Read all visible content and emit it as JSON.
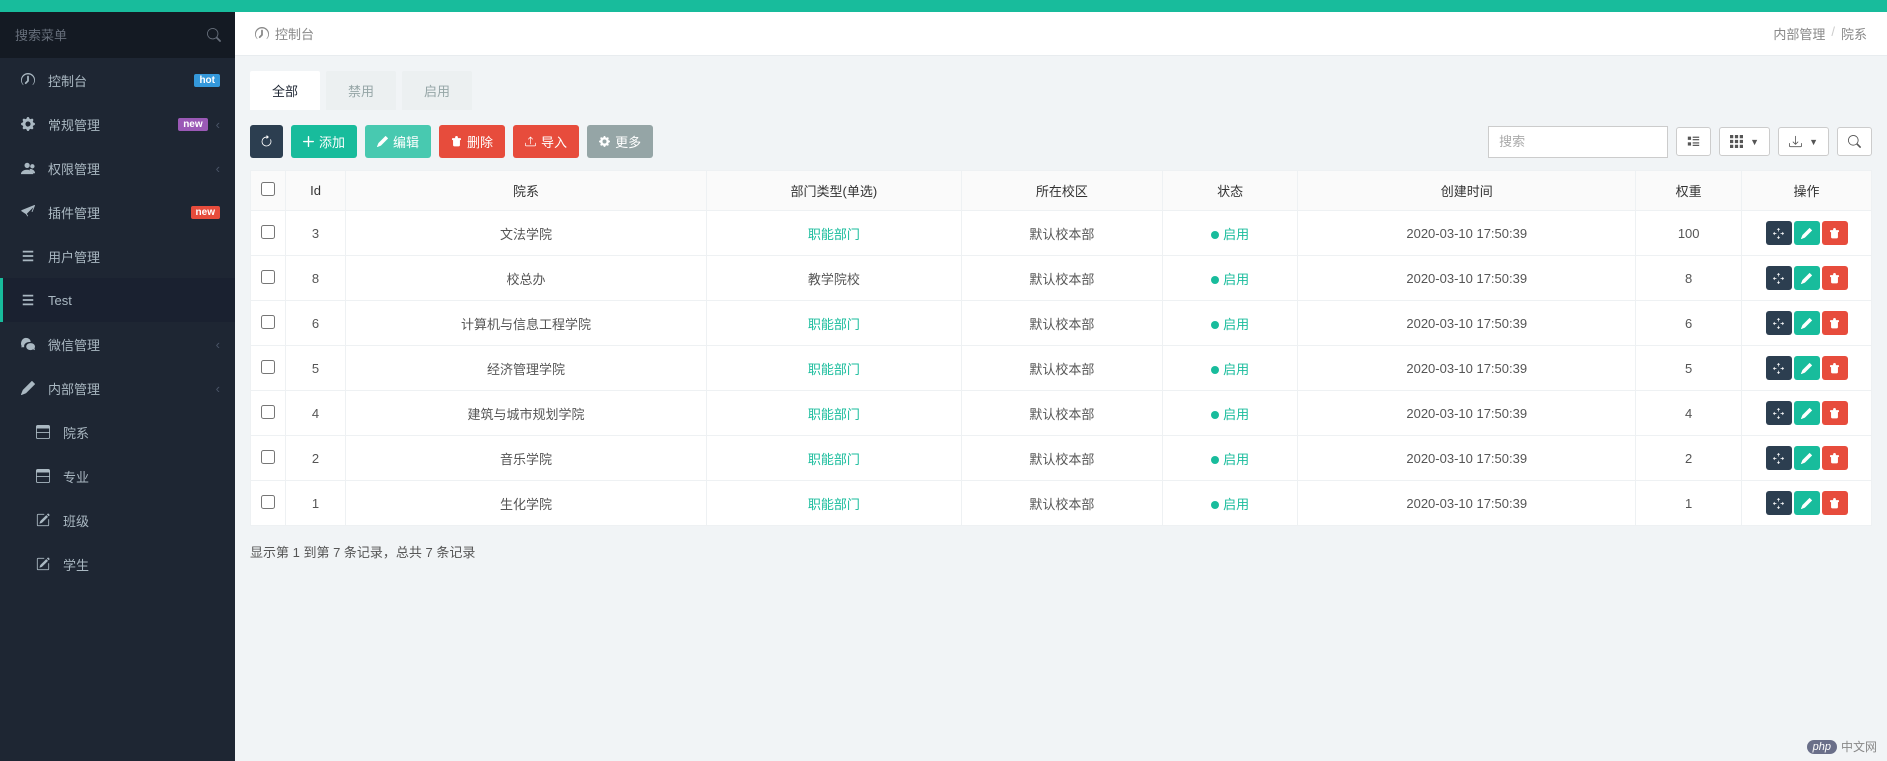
{
  "sidebar": {
    "search_placeholder": "搜索菜单",
    "items": [
      {
        "icon": "dashboard",
        "label": "控制台",
        "badge": "hot",
        "badge_class": "badge-hot"
      },
      {
        "icon": "gear",
        "label": "常规管理",
        "badge": "new",
        "badge_class": "badge-new",
        "caret": true
      },
      {
        "icon": "users",
        "label": "权限管理",
        "caret": true
      },
      {
        "icon": "plane",
        "label": "插件管理",
        "badge": "new",
        "badge_class": "badge-new-red"
      },
      {
        "icon": "list",
        "label": "用户管理"
      },
      {
        "icon": "list",
        "label": "Test",
        "active": true
      },
      {
        "icon": "wechat",
        "label": "微信管理",
        "caret": true
      },
      {
        "icon": "pencil",
        "label": "内部管理",
        "caret": true,
        "selected_box": true
      }
    ],
    "sub_items": [
      {
        "icon": "table",
        "label": "院系"
      },
      {
        "icon": "table",
        "label": "专业"
      },
      {
        "icon": "edit",
        "label": "班级"
      },
      {
        "icon": "edit",
        "label": "学生"
      }
    ]
  },
  "breadcrumb": {
    "title": "控制台",
    "path1": "内部管理",
    "path2": "院系"
  },
  "tabs": [
    {
      "label": "全部",
      "active": true
    },
    {
      "label": "禁用"
    },
    {
      "label": "启用"
    }
  ],
  "toolbar": {
    "add": "添加",
    "edit": "编辑",
    "delete": "删除",
    "import": "导入",
    "more": "更多",
    "search_placeholder": "搜索"
  },
  "table": {
    "headers": {
      "id": "Id",
      "dept": "院系",
      "type": "部门类型(单选)",
      "campus": "所在校区",
      "status": "状态",
      "created": "创建时间",
      "weight": "权重",
      "ops": "操作"
    },
    "rows": [
      {
        "id": "3",
        "dept": "文法学院",
        "type": "职能部门",
        "type_link": true,
        "campus": "默认校本部",
        "status": "启用",
        "created": "2020-03-10 17:50:39",
        "weight": "100"
      },
      {
        "id": "8",
        "dept": "校总办",
        "type": "教学院校",
        "type_link": false,
        "campus": "默认校本部",
        "status": "启用",
        "created": "2020-03-10 17:50:39",
        "weight": "8"
      },
      {
        "id": "6",
        "dept": "计算机与信息工程学院",
        "type": "职能部门",
        "type_link": true,
        "campus": "默认校本部",
        "status": "启用",
        "created": "2020-03-10 17:50:39",
        "weight": "6"
      },
      {
        "id": "5",
        "dept": "经济管理学院",
        "type": "职能部门",
        "type_link": true,
        "campus": "默认校本部",
        "status": "启用",
        "created": "2020-03-10 17:50:39",
        "weight": "5"
      },
      {
        "id": "4",
        "dept": "建筑与城市规划学院",
        "type": "职能部门",
        "type_link": true,
        "campus": "默认校本部",
        "status": "启用",
        "created": "2020-03-10 17:50:39",
        "weight": "4"
      },
      {
        "id": "2",
        "dept": "音乐学院",
        "type": "职能部门",
        "type_link": true,
        "campus": "默认校本部",
        "status": "启用",
        "created": "2020-03-10 17:50:39",
        "weight": "2"
      },
      {
        "id": "1",
        "dept": "生化学院",
        "type": "职能部门",
        "type_link": true,
        "campus": "默认校本部",
        "status": "启用",
        "created": "2020-03-10 17:50:39",
        "weight": "1"
      }
    ]
  },
  "pagination_info": "显示第 1 到第 7 条记录，总共 7 条记录",
  "credit": {
    "badge": "php",
    "text": "中文网"
  }
}
